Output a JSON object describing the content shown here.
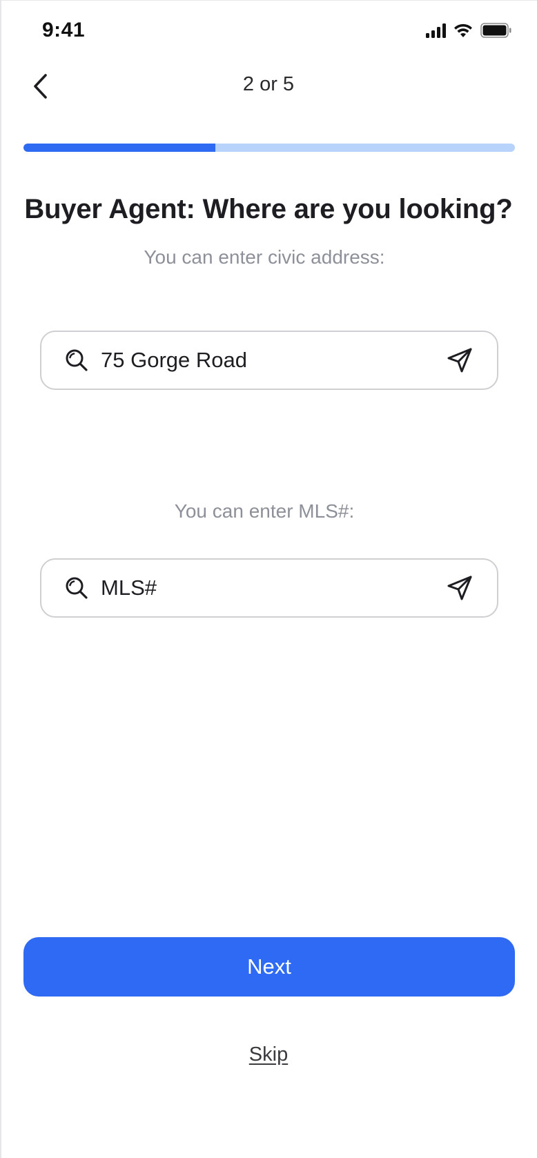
{
  "status_bar": {
    "time": "9:41",
    "signal_icon": "cellular-signal-icon",
    "wifi_icon": "wifi-icon",
    "battery_icon": "battery-icon"
  },
  "header": {
    "back_icon": "chevron-left-icon",
    "step_label": "2 or 5"
  },
  "progress": {
    "fraction": 0.39,
    "accent": "#2f6bf2",
    "track": "#b8d3fb"
  },
  "title": "Buyer Agent: Where are you looking?",
  "civic": {
    "hint": "You can enter civic address:",
    "value": "75 Gorge Road",
    "placeholder": "",
    "search_icon": "search-icon",
    "send_icon": "send-icon"
  },
  "mls": {
    "hint": "You can enter MLS#:",
    "value": "",
    "placeholder": "MLS#",
    "search_icon": "search-icon",
    "send_icon": "send-icon"
  },
  "actions": {
    "next_label": "Next",
    "skip_label": "Skip",
    "primary_color": "#2e6af3"
  }
}
